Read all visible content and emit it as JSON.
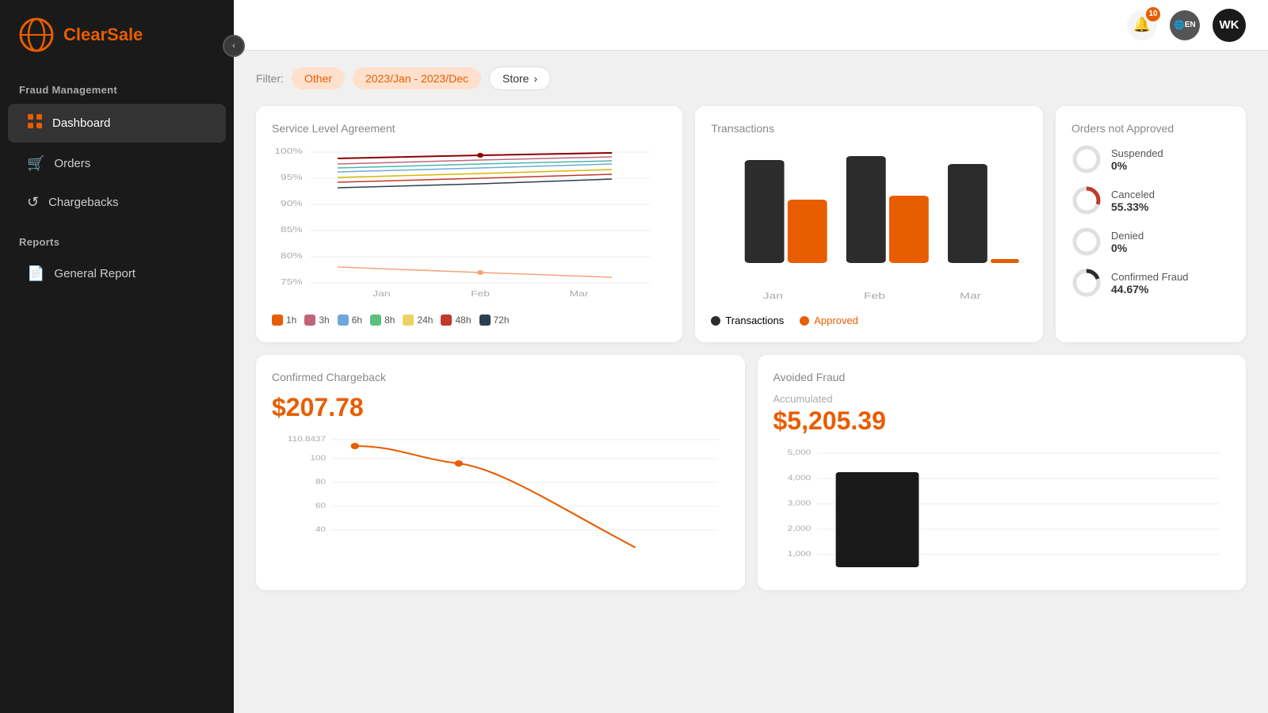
{
  "app": {
    "name": "ClearSale"
  },
  "sidebar": {
    "section1": "Fraud Management",
    "items": [
      {
        "id": "dashboard",
        "label": "Dashboard",
        "icon": "⊞",
        "active": true
      },
      {
        "id": "orders",
        "label": "Orders",
        "icon": "🛒",
        "active": false
      },
      {
        "id": "chargebacks",
        "label": "Chargebacks",
        "icon": "↺",
        "active": false
      }
    ],
    "section2": "Reports",
    "reports_items": [
      {
        "id": "general-report",
        "label": "General Report",
        "icon": "📄",
        "active": false
      }
    ],
    "collapse_icon": "‹"
  },
  "header": {
    "notifications_count": "10",
    "language": "EN",
    "user_initials": "WK"
  },
  "filter": {
    "label": "Filter:",
    "chip1": "Other",
    "chip2": "2023/Jan - 2023/Dec",
    "chip3": "Store",
    "chevron": "›"
  },
  "sla": {
    "title": "Service Level Agreement",
    "y_labels": [
      "100%",
      "95%",
      "90%",
      "85%",
      "80%",
      "75%"
    ],
    "x_labels": [
      "Jan",
      "Feb",
      "Mar"
    ],
    "legend": [
      {
        "label": "1h",
        "color": "#e85d00",
        "checked": true
      },
      {
        "label": "3h",
        "color": "#c0647a",
        "checked": true
      },
      {
        "label": "6h",
        "color": "#6ea8d8",
        "checked": true
      },
      {
        "label": "8h",
        "color": "#5dbf7e",
        "checked": true
      },
      {
        "label": "24h",
        "color": "#f0d060",
        "checked": true
      },
      {
        "label": "48h",
        "color": "#c0392b",
        "checked": true
      },
      {
        "label": "72h",
        "color": "#2c3e50",
        "checked": true
      }
    ]
  },
  "transactions": {
    "title": "Transactions",
    "x_labels": [
      "Jan",
      "Feb",
      "Mar"
    ],
    "legend": [
      {
        "label": "Transactions",
        "color": "#2c2c2c"
      },
      {
        "label": "Approved",
        "color": "#e85d00"
      }
    ]
  },
  "orders_not_approved": {
    "title": "Orders not Approved",
    "stats": [
      {
        "label": "Suspended",
        "value": "0%",
        "percent": 0,
        "color": "#ccc"
      },
      {
        "label": "Canceled",
        "value": "55.33%",
        "percent": 55.33,
        "color": "#c0392b"
      },
      {
        "label": "Denied",
        "value": "0%",
        "percent": 0,
        "color": "#ccc"
      },
      {
        "label": "Confirmed Fraud",
        "value": "44.67%",
        "percent": 44.67,
        "color": "#2c2c2c"
      }
    ]
  },
  "chargeback": {
    "title": "Confirmed Chargeback",
    "value": "$207.78",
    "y_labels": [
      "110.8437",
      "100",
      "80",
      "60",
      "40"
    ]
  },
  "avoided_fraud": {
    "title": "Avoided Fraud",
    "accumulated_label": "Accumulated",
    "value": "$5,205.39",
    "y_labels": [
      "5,000",
      "4,000",
      "3,000",
      "2,000",
      "1,000"
    ]
  }
}
